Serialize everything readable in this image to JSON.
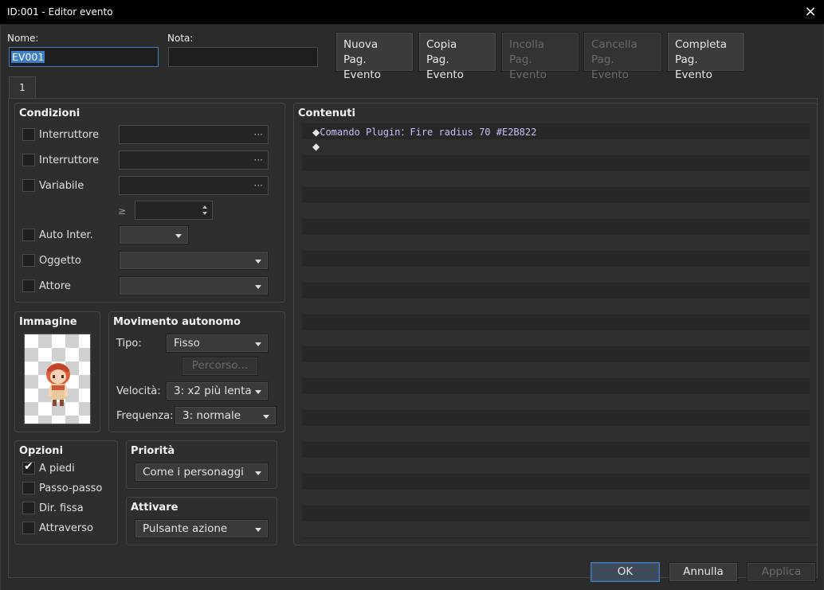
{
  "window": {
    "title": "ID:001 - Editor evento",
    "close_icon": "×"
  },
  "header": {
    "name_label": "Nome:",
    "name_value": "EV001",
    "note_label": "Nota:",
    "note_value": "",
    "buttons": [
      {
        "line1": "Nuova",
        "line2": "Pag. Evento",
        "enabled": true
      },
      {
        "line1": "Copia",
        "line2": "Pag. Evento",
        "enabled": true
      },
      {
        "line1": "Incolla",
        "line2": "Pag. Evento",
        "enabled": false
      },
      {
        "line1": "Cancella",
        "line2": "Pag. Evento",
        "enabled": false
      },
      {
        "line1": "Completa",
        "line2": "Pag. Evento",
        "enabled": true
      }
    ]
  },
  "tabs": [
    {
      "label": "1"
    }
  ],
  "conditions": {
    "title": "Condizioni",
    "switch1_label": "Interruttore",
    "switch2_label": "Interruttore",
    "variable_label": "Variabile",
    "gte_symbol": "≥",
    "self_switch_label": "Auto Inter.",
    "item_label": "Oggetto",
    "actor_label": "Attore",
    "dots": "···"
  },
  "image": {
    "title": "Immagine"
  },
  "autonomous": {
    "title": "Movimento autonomo",
    "type_label": "Tipo:",
    "type_value": "Fisso",
    "route_button": "Percorso...",
    "speed_label": "Velocità:",
    "speed_value": "3: x2 più lenta",
    "freq_label": "Frequenza:",
    "freq_value": "3: normale"
  },
  "options": {
    "title": "Opzioni",
    "items": [
      {
        "label": "A piedi",
        "checked": true
      },
      {
        "label": "Passo-passo",
        "checked": false
      },
      {
        "label": "Dir. fissa",
        "checked": false
      },
      {
        "label": "Attraverso",
        "checked": false
      }
    ]
  },
  "priority": {
    "title": "Priorità",
    "value": "Come i personaggi"
  },
  "trigger": {
    "title": "Attivare",
    "value": "Pulsante azione"
  },
  "contents": {
    "title": "Contenuti",
    "lines": [
      "Comando Plugin：Fire radius 70 #E2B822",
      ""
    ],
    "bullet": "◆"
  },
  "footer": {
    "ok": "OK",
    "cancel": "Annulla",
    "apply": "Applica"
  },
  "colors": {
    "accent": "#3f7fc7",
    "command_text": "#c5c0ff",
    "background": "#2b2b2b"
  }
}
